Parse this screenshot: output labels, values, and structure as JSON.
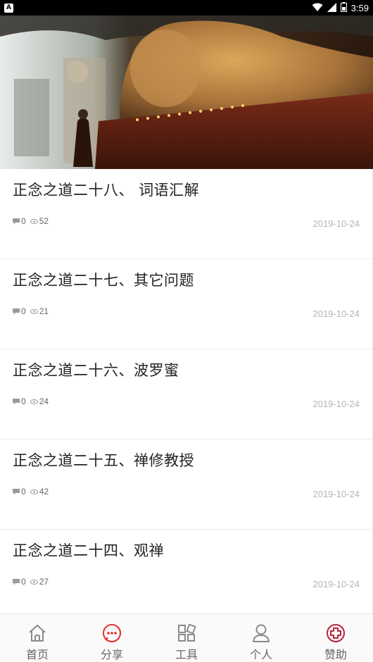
{
  "status_bar": {
    "time": "3:59",
    "left_badge": "A"
  },
  "hero": {
    "image": "reclining-buddha-cave-banner"
  },
  "articles": [
    {
      "title": "正念之道二十八、 词语汇解",
      "comments": "0",
      "views": "52",
      "date": "2019-10-24"
    },
    {
      "title": "正念之道二十七、其它问题",
      "comments": "0",
      "views": "21",
      "date": "2019-10-24"
    },
    {
      "title": "正念之道二十六、波罗蜜",
      "comments": "0",
      "views": "24",
      "date": "2019-10-24"
    },
    {
      "title": "正念之道二十五、禅修教授",
      "comments": "0",
      "views": "42",
      "date": "2019-10-24"
    },
    {
      "title": "正念之道二十四、观禅",
      "comments": "0",
      "views": "27",
      "date": "2019-10-24"
    }
  ],
  "bottom_nav": {
    "items": [
      {
        "label": "首页",
        "icon": "home-icon",
        "color": "#888888"
      },
      {
        "label": "分享",
        "icon": "chat-bubble-icon",
        "color": "#e0302c"
      },
      {
        "label": "工具",
        "icon": "grid-tools-icon",
        "color": "#888888"
      },
      {
        "label": "个人",
        "icon": "person-icon",
        "color": "#888888"
      },
      {
        "label": "赞助",
        "icon": "red-cross-icon",
        "color": "#b8243a"
      }
    ]
  }
}
